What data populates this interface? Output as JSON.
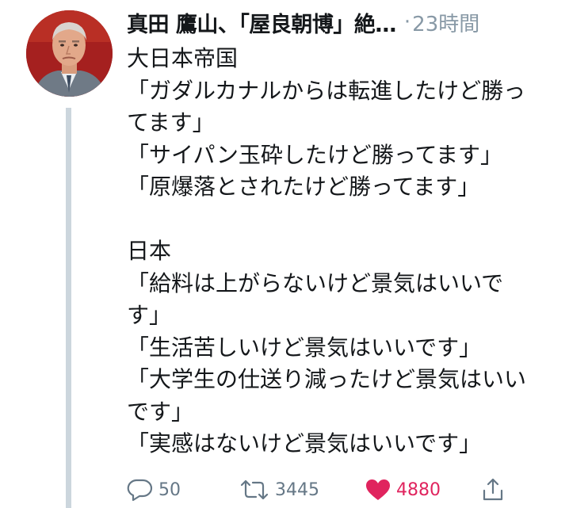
{
  "tweet": {
    "author_name": "真田 鷹山、「屋良朝博」絶…",
    "separator": "·",
    "timestamp": "23時間",
    "lines": [
      "大日本帝国",
      "「ガダルカナルからは転進したけど勝っ",
      "てます」",
      "「サイパン玉砕したけど勝ってます」",
      "「原爆落とされたけど勝ってます」",
      "",
      "日本",
      "「給料は上がらないけど景気はいいで",
      "す」",
      "「生活苦しいけど景気はいいです」",
      "「大学生の仕送り減ったけど景気はいい",
      "です」",
      "「実感はないけど景気はいいです」"
    ]
  },
  "actions": {
    "reply_count": "50",
    "retweet_count": "3445",
    "like_count": "4880",
    "reply_icon": "reply-icon",
    "retweet_icon": "retweet-icon",
    "like_icon": "heart-icon",
    "share_icon": "share-icon"
  },
  "colors": {
    "text": "#14171a",
    "muted": "#8899a6",
    "action": "#657786",
    "like": "#e0245e",
    "thread_line": "#ccd6dd"
  }
}
